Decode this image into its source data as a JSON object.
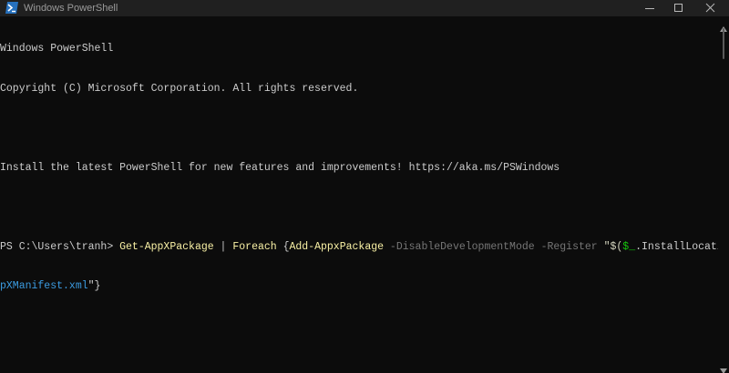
{
  "window": {
    "title": "Windows PowerShell"
  },
  "console": {
    "banner_line1": "Windows PowerShell",
    "banner_line2": "Copyright (C) Microsoft Corporation. All rights reserved.",
    "install_line": "Install the latest PowerShell for new features and improvements! https://aka.ms/PSWindows",
    "prompt": "PS C:\\Users\\tranh> ",
    "cmd_get": "Get-AppXPackage",
    "cmd_pipe": " | ",
    "cmd_foreach": "Foreach",
    "cmd_brace_open": " {",
    "cmd_add": "Add-AppxPackage",
    "cmd_param1": " -DisableDevelopmentMode",
    "cmd_param2": " -Register",
    "cmd_str_open": " \"$(",
    "cmd_var": "$_",
    "cmd_prop": ".InstallLocation)",
    "cmd_tail1": "Ap",
    "cmd_tail2": "pXManifest.xml",
    "cmd_end": "\"}"
  },
  "colors": {
    "background": "#0c0c0c",
    "titlebar": "#202020",
    "text": "#cccccc",
    "cmdlet": "#f9f1a5",
    "parameter": "#767676",
    "variable": "#16c60c",
    "continuation": "#3b9be0"
  },
  "icons": {
    "app": "powershell-icon",
    "minimize": "minimize-icon",
    "maximize": "maximize-icon",
    "close": "close-icon",
    "scroll_up": "scroll-up-arrow-icon",
    "scroll_down": "scroll-down-arrow-icon"
  }
}
